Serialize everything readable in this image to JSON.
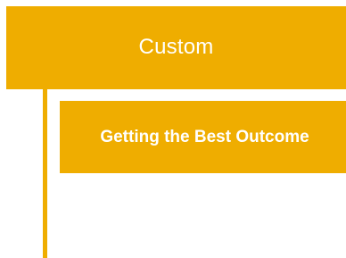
{
  "diagram": {
    "type": "hierarchy",
    "accent_color": "#efad00",
    "text_color": "#ffffff",
    "background_color": "#ffffff",
    "parent": {
      "label": "Custom"
    },
    "children": [
      {
        "label": "Getting the Best Outcome"
      }
    ]
  }
}
